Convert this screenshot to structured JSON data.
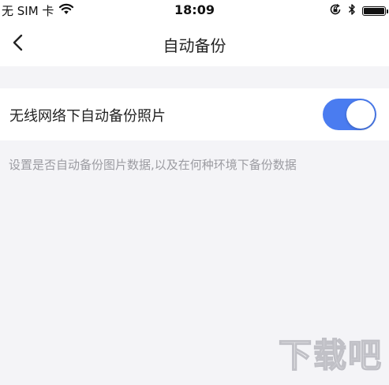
{
  "status_bar": {
    "carrier": "无 SIM 卡",
    "time": "18:09",
    "battery_level": 1.0
  },
  "nav": {
    "title": "自动备份"
  },
  "setting": {
    "label": "无线网络下自动备份照片",
    "enabled": true,
    "accent_color": "#4a7cf0"
  },
  "description": "设置是否自动备份图片数据,以及在何种环境下备份数据",
  "watermark": "下载吧",
  "icons": [
    "wifi-icon",
    "orientation-lock-icon",
    "bluetooth-icon",
    "battery-icon",
    "back-chevron-icon"
  ]
}
